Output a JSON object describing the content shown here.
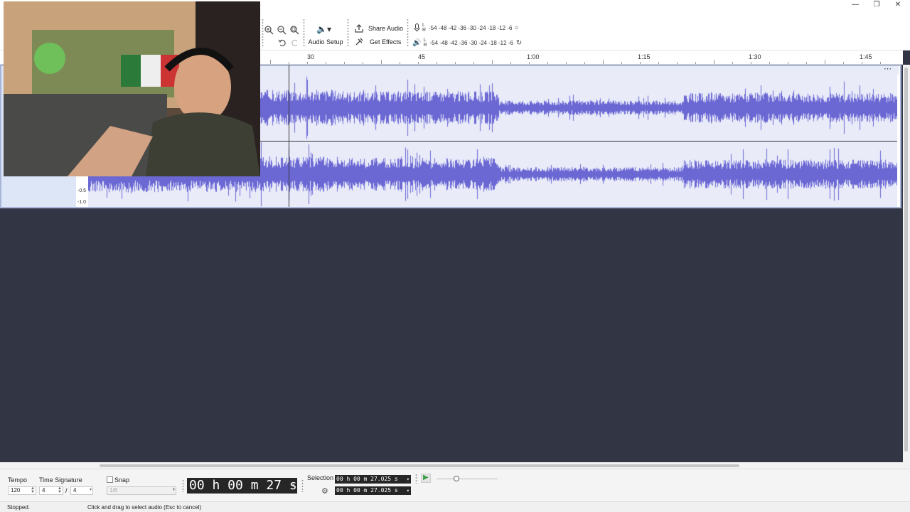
{
  "window": {
    "minimize_icon": "minimize-icon",
    "maximize_icon": "restore-icon",
    "close_icon": "close-icon"
  },
  "toolbar": {
    "zoom_icons": [
      "zoom-in-icon",
      "zoom-out-icon",
      "zoom-fit-icon"
    ],
    "undo_icon": "undo-icon",
    "redo_icon": "redo-icon",
    "audio_setup_label": "Audio Setup",
    "share_audio_label": "Share Audio",
    "get_effects_label": "Get Effects",
    "record_meter": {
      "lr": "L\nR",
      "ticks": "-54 -48 -42 -36 -30 -24 -18 -12 -6"
    },
    "play_meter": {
      "lr": "L\nR",
      "ticks": "-54 -48 -42 -36 -30 -24 -18 -12 -6"
    }
  },
  "timeline": {
    "labels": [
      "30",
      "45",
      "1:00",
      "1:15",
      "1:30",
      "1:45"
    ]
  },
  "track": {
    "menu_label": "⋯",
    "scale_lower": [
      "-0.5",
      "-1.0"
    ],
    "waveform_color": "#6b68d4"
  },
  "bottom": {
    "tempo_label": "Tempo",
    "tempo_value": "120",
    "time_signature_label": "Time Signature",
    "ts_numerator": "4",
    "ts_separator": "/",
    "ts_denominator": "4",
    "snap_label": "Snap",
    "snap_value": "1/8",
    "time_display": "00 h 00 m 27 s",
    "selection_label": "Selection",
    "selection_start": "00 h 00 m 27.025 s",
    "selection_end": "00 h 00 m 27.025 s"
  },
  "status": {
    "state": "Stopped.",
    "hint": "Click and drag to select audio (Esc to cancel)"
  },
  "colors": {
    "accent": "#6b68d4",
    "background": "#323644",
    "track_selected": "#dde6f7"
  }
}
